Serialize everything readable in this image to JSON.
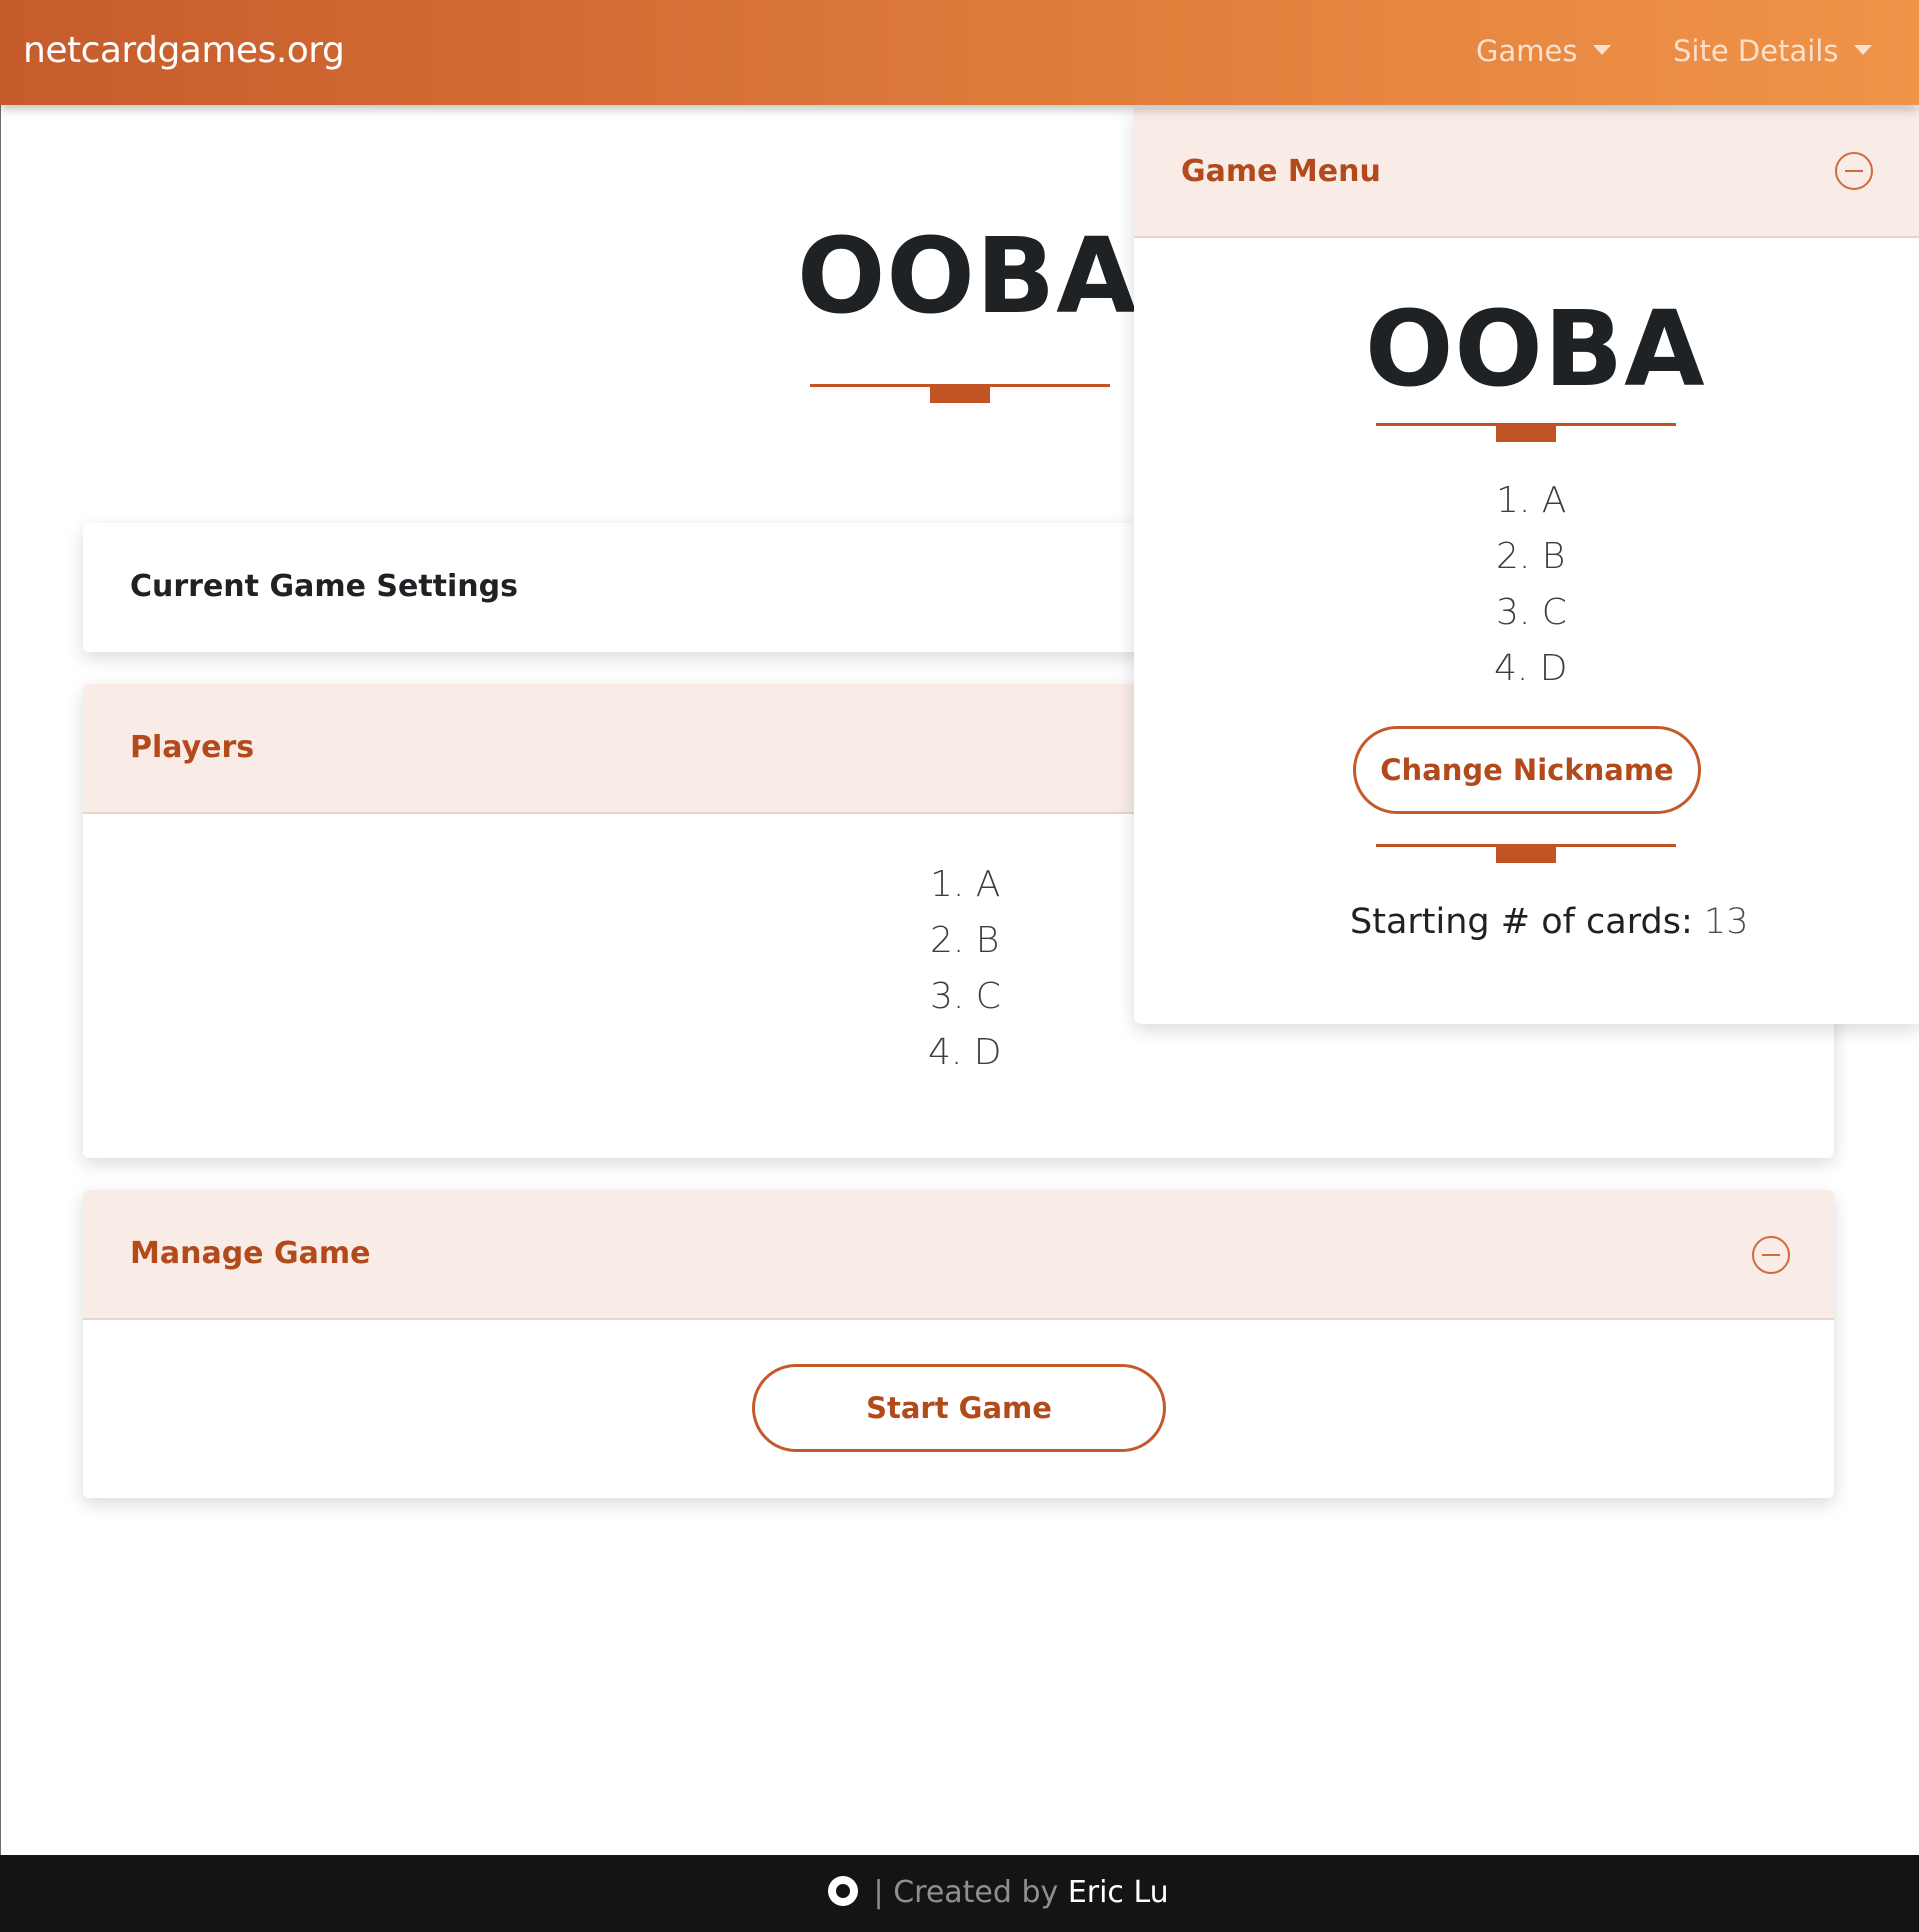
{
  "navbar": {
    "brand": "netcardgames.org",
    "games_label": "Games",
    "site_details_label": "Site Details"
  },
  "main": {
    "title": "OOBA",
    "settings_card": {
      "title": "Current Game Settings"
    },
    "players_card": {
      "title": "Players",
      "players": [
        "1. A",
        "2. B",
        "3. C",
        "4. D"
      ]
    },
    "manage_card": {
      "title": "Manage Game",
      "start_button": "Start Game"
    }
  },
  "game_menu": {
    "header": "Game Menu",
    "title": "OOBA",
    "players": [
      "1. A",
      "2. B",
      "3. C",
      "4. D"
    ],
    "change_nickname_button": "Change Nickname",
    "starting_cards_label": "Starting # of cards:",
    "starting_cards_value": "13"
  },
  "footer": {
    "separator": "|",
    "created_by": "Created by",
    "author": "Eric Lu"
  },
  "colors": {
    "navbar_start": "#c65b2c",
    "navbar_end": "#f0944a",
    "accent": "#b24a1c",
    "header_tint": "#f9ebe6",
    "footer_bg": "#141414"
  },
  "icons": {
    "collapse": "minus-circle-icon",
    "dropdown": "caret-down-icon",
    "github": "github-icon"
  }
}
